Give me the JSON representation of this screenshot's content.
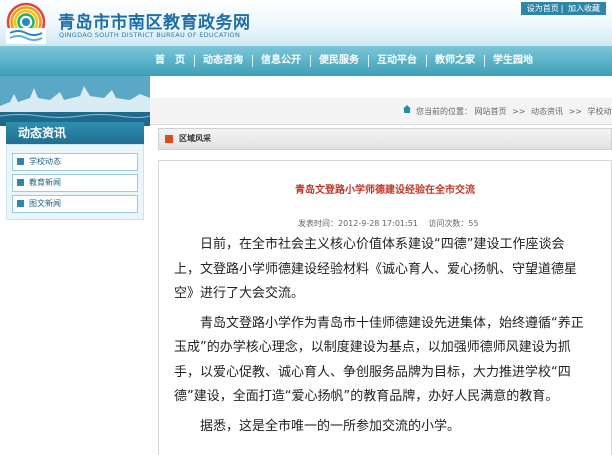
{
  "header": {
    "toplinks": [
      "设为首页",
      "加入收藏"
    ],
    "title": "青岛市市南区教育政务网",
    "subtitle": "QINGDAO SOUTH DISTRICT BUREAU OF EDUCATION"
  },
  "nav": {
    "items": [
      "首　页",
      "动态咨询",
      "信息公开",
      "便民服务",
      "互动平台",
      "教师之家",
      "学生园地"
    ]
  },
  "sidebar": {
    "title": "动态资讯",
    "items": [
      {
        "label": "学校动态"
      },
      {
        "label": "教育新闻"
      },
      {
        "label": "图文新闻"
      }
    ]
  },
  "breadcrumb": {
    "prefix": "您当前的位置：",
    "items": [
      "网站首页",
      "动态资讯",
      "学校动态"
    ]
  },
  "section": {
    "title": "区域风采"
  },
  "article": {
    "title": "青岛文登路小学师德建设经验在全市交流",
    "meta": {
      "published": "发表时间：2012-9-28 17:01:51",
      "views": "访问次数：55"
    },
    "paragraphs": [
      "日前，在全市社会主义核心价值体系建设“四德”建设工作座谈会上，文登路小学师德建设经验材料《诚心育人、爱心扬帆、守望道德星空》进行了大会交流。",
      "青岛文登路小学作为青岛市十佳师德建设先进集体，始终遵循“养正玉成”的办学核心理念，以制度建设为基点，以加强师德师风建设为抓手，以爱心促教、诚心育人、争创服务品牌为目标，大力推进学校“四德”建设，全面打造“爱心扬帆”的教育品牌，办好人民满意的教育。",
      "据悉，这是全市唯一的一所参加交流的小学。"
    ]
  },
  "colors": {
    "brand_blue": "#1c6fa8",
    "nav_bg": "#3c9fb8",
    "title_red": "#c0392b",
    "section_mark": "#e04a1a"
  },
  "icons": {
    "logo": "rainbow-sun-logo",
    "home": "home-icon",
    "bullet": "square-bullet-icon"
  }
}
